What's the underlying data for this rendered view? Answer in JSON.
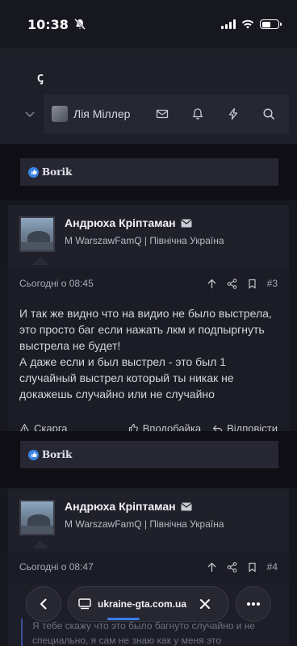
{
  "status_bar": {
    "time": "10:38"
  },
  "header": {
    "logo_fragment": "ꞔ",
    "user_name": "Лія Міллер"
  },
  "reactions": [
    {
      "name": "Borik"
    },
    {
      "name": "Borik"
    }
  ],
  "posts": [
    {
      "author": "Андрюха Кріптаман",
      "meta": "M WarszawFamQ | Північна Україна",
      "date": "Сьогодні о 08:45",
      "number": "#3",
      "body": [
        "И так же видно что на видио не было выстрела, это просто баг если нажать лкм и подпыргнуть выстрела не будет!",
        "А даже если и был выстрел - это был 1 случайный выстрел который ты никак не докажешь случайно или не случайно"
      ],
      "report_label": "Скарга",
      "like_label": "Вподобайка",
      "reply_label": "Відповісти"
    },
    {
      "author": "Андрюха Кріптаман",
      "meta": "M WarszawFamQ | Північна Україна",
      "date": "Сьогодні о 08:47",
      "number": "#4",
      "quote_preview": "Я тебе скажу что это было багнуто случайно и не специально, я сам не знаю как у меня это"
    }
  ],
  "browser": {
    "url": "ukraine-gta.com.ua"
  },
  "colors": {
    "accent": "#3a7bea",
    "like": "#3a84e4",
    "background": "#17171f"
  }
}
